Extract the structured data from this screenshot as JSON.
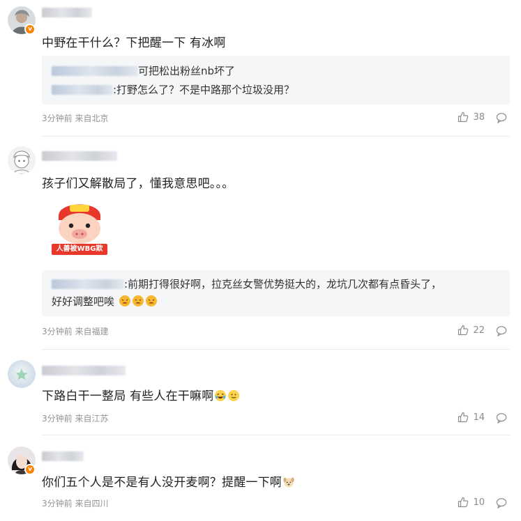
{
  "comments": [
    {
      "text": "中野在干什么？下把醒一下 有冰啊",
      "replies": [
        {
          "text": "可把松出粉丝nb坏了"
        },
        {
          "text": ":打野怎么了？不是中路那个垃圾没用？"
        }
      ],
      "meta": "3分钟前 来自北京",
      "likes": "38",
      "verified": "v"
    },
    {
      "text": "孩子们又解散局了，懂我意思吧。。。",
      "sticker_caption": "人善被WBG欺",
      "replies": [
        {
          "text": ":前期打得很好啊，拉克丝女警优势挺大的，龙坑几次都有点昏头了，"
        },
        {
          "text": "好好调整吧唉"
        }
      ],
      "meta": "3分钟前 来自福建",
      "likes": "22"
    },
    {
      "text": "下路白干一整局 有些人在干嘛啊",
      "meta": "3分钟前 来自江苏",
      "likes": "14"
    },
    {
      "text": "你们五个人是不是有人没开麦啊？提醒一下啊",
      "meta": "3分钟前 来自四川",
      "likes": "10",
      "verified": "v"
    }
  ],
  "icons": {
    "like": "thumbs-up-icon",
    "reply": "comment-bubble-icon"
  },
  "colors": {
    "verified_badge": "#ff8200",
    "meta_text": "#939393",
    "reply_bg": "#f5f6f8"
  }
}
